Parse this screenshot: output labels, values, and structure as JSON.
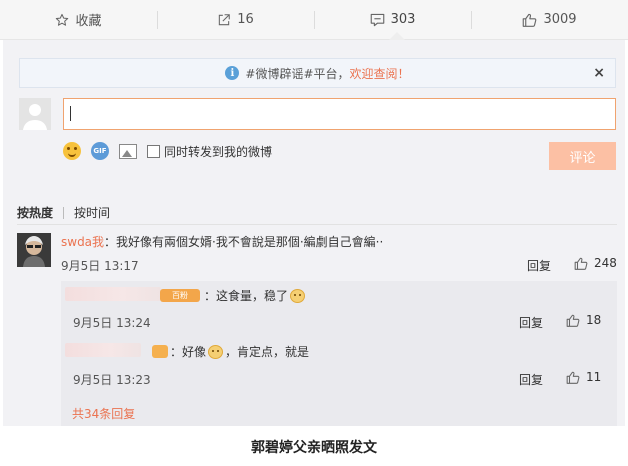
{
  "actions": {
    "favorite": {
      "label": "收藏",
      "icon": "star-icon"
    },
    "repost": {
      "count": "16",
      "icon": "share-icon"
    },
    "comment": {
      "count": "303",
      "icon": "comment-icon"
    },
    "like": {
      "count": "3009",
      "icon": "thumbs-up-icon"
    }
  },
  "notice": {
    "text": "#微博辟谣#平台，",
    "link": "欢迎查阅！",
    "close": "×"
  },
  "composer": {
    "input_value": "",
    "repost_label": "同时转发到我的微博",
    "repost_checked": false,
    "submit_label": "评论",
    "submit_color": "#fcc0a4"
  },
  "sort": {
    "tabs": [
      "按热度",
      "按时间"
    ],
    "active": "按热度"
  },
  "comments": [
    {
      "user": "swda我",
      "text": "：我好像有兩個女婿·我不會說是那個·編劇自己會編··",
      "time": "9月5日 13:17",
      "reply_label": "回复",
      "likes": "248",
      "replies": [
        {
          "badge": "百粉",
          "text": "：这食量，稳了",
          "time": "9月5日 13:24",
          "reply_label": "回复",
          "likes": "18"
        },
        {
          "text": "：好像",
          "text_after": "，肯定点，就是",
          "time": "9月5日 13:23",
          "reply_label": "回复",
          "likes": "11"
        }
      ],
      "more_replies": "共34条回复"
    }
  ],
  "caption": "郭碧婷父亲晒照发文",
  "colors": {
    "accent": "#eb7350",
    "input_border": "#f0a36f",
    "info_icon": "#5aa0d8"
  }
}
